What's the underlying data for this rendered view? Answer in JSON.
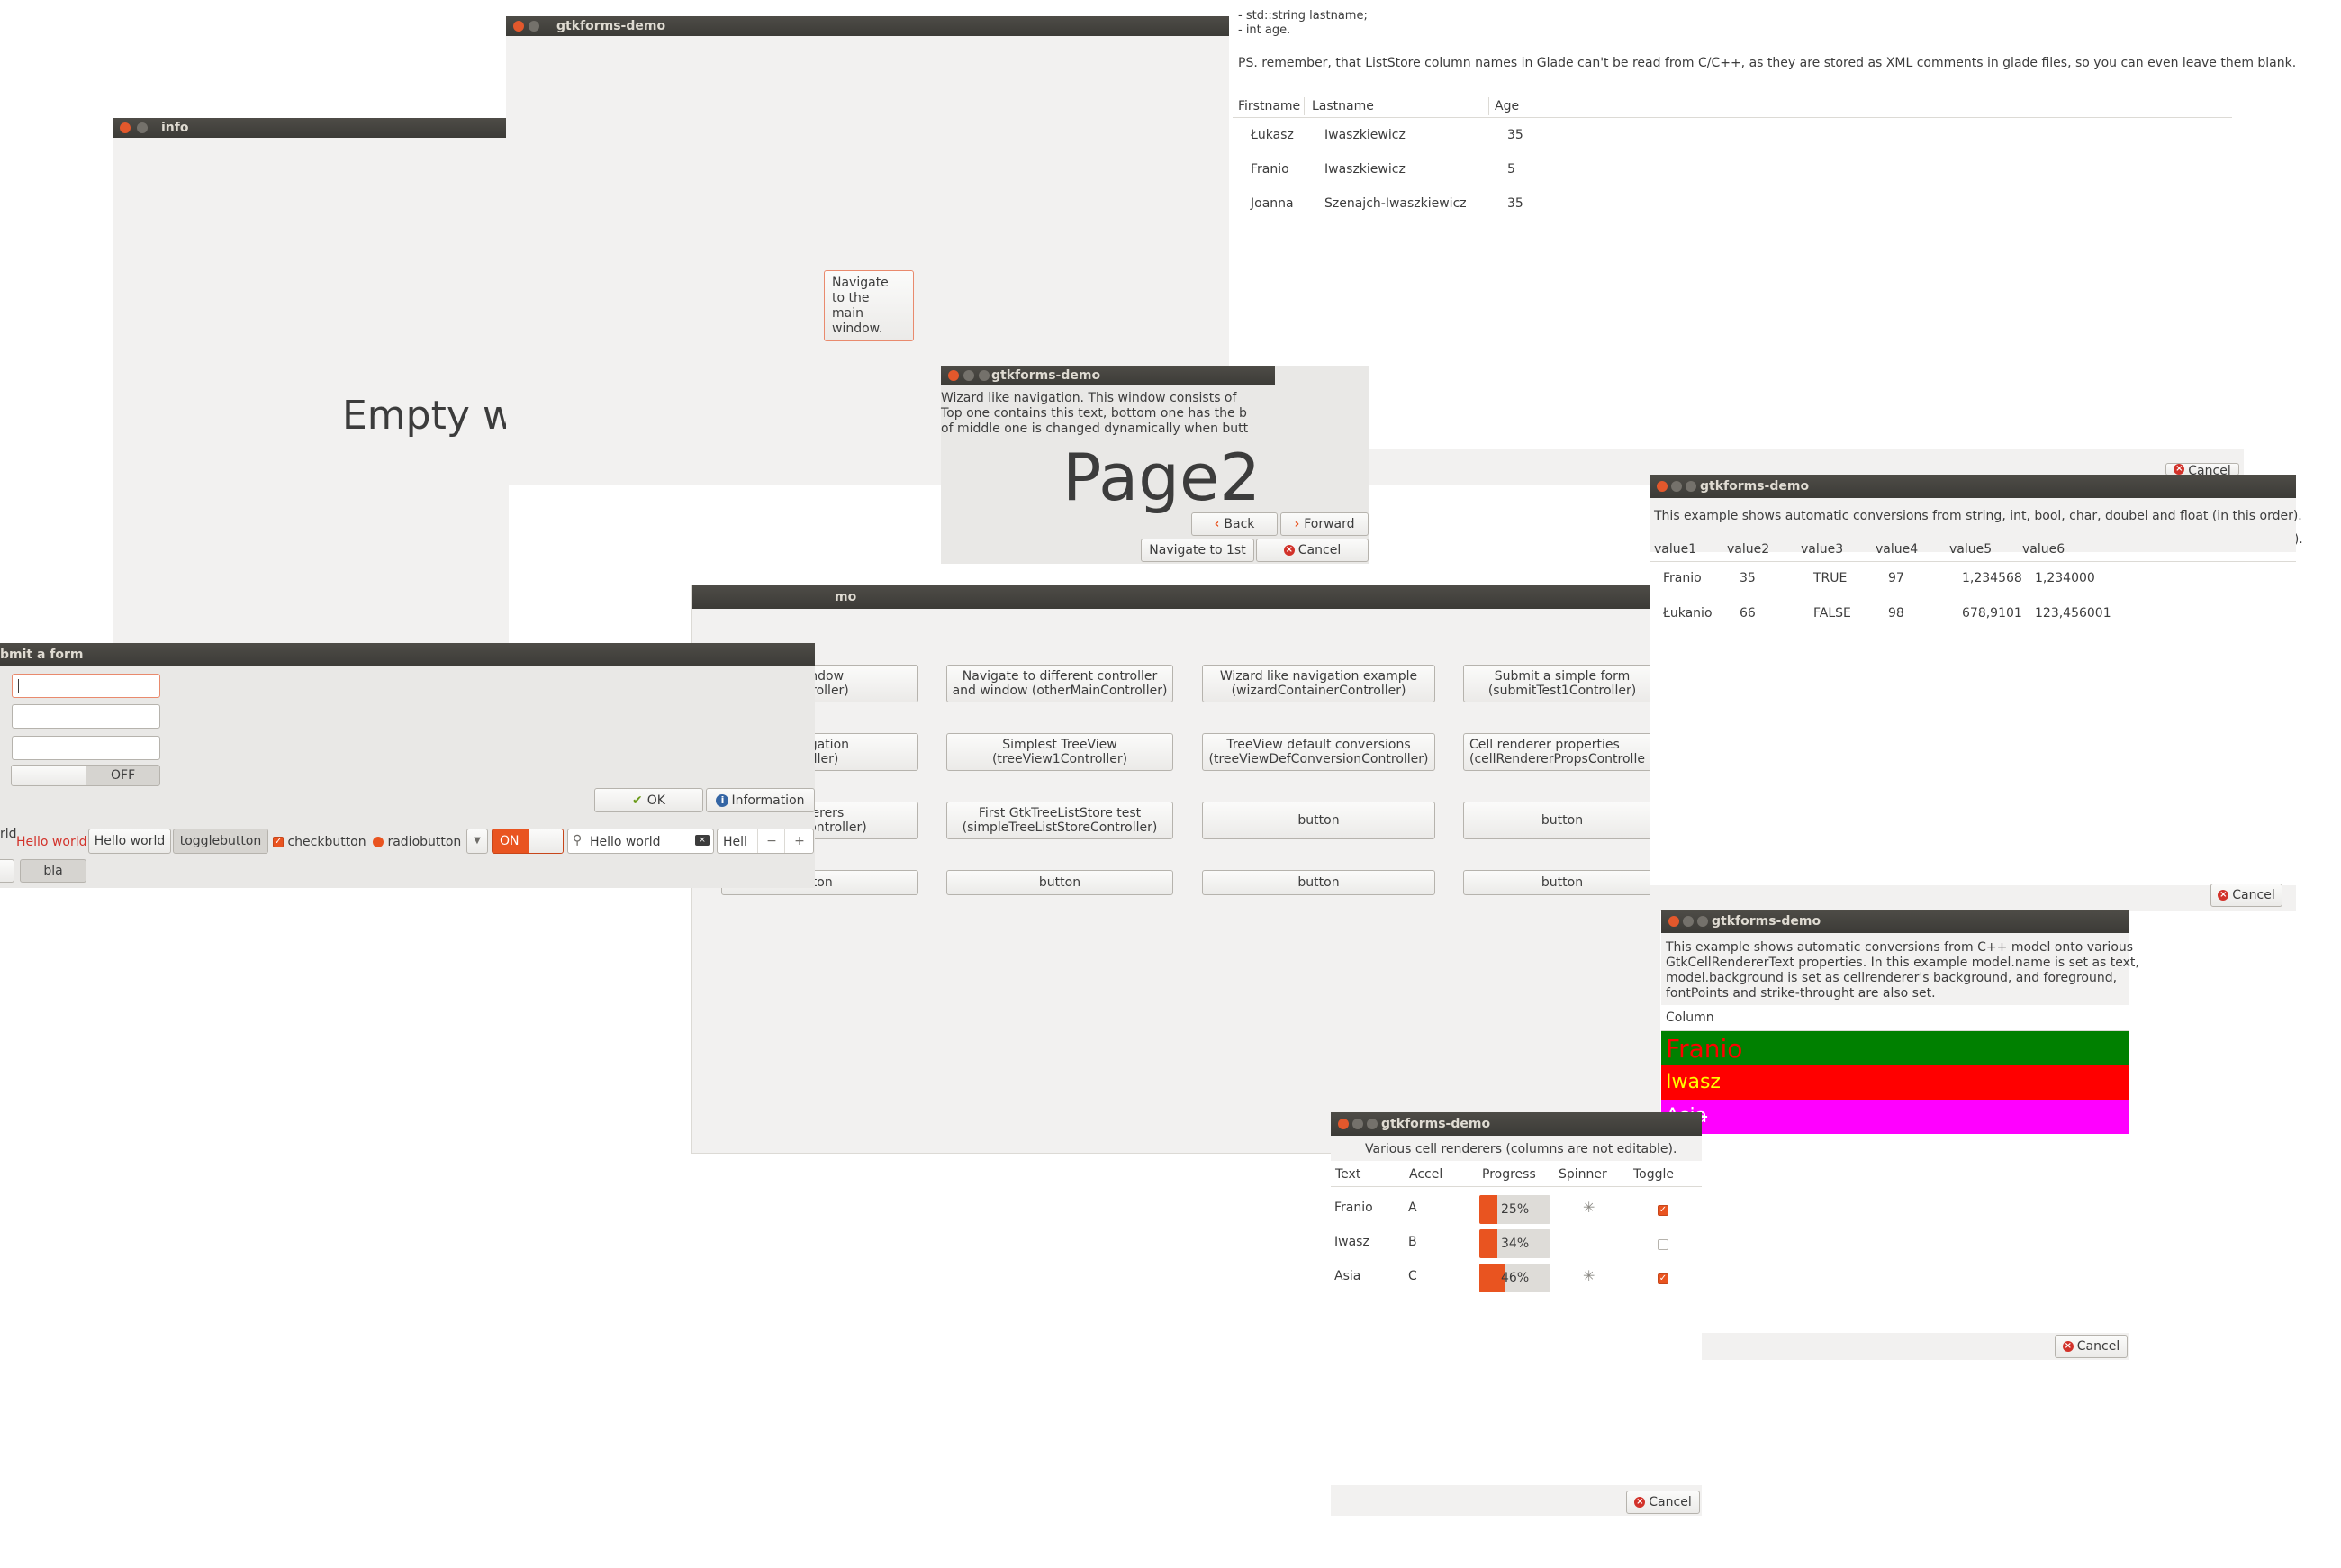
{
  "colors": {
    "accent": "#e95420",
    "titlebar": "#3c3b37",
    "window_bg": "#f2f1f0",
    "green_row": "#008000",
    "red_row": "#ff0000",
    "magenta_row": "#ff00ff"
  },
  "top_main": {
    "title": "gtkforms-demo",
    "nav_button": "Navigate to the main window.",
    "top_text_a": "- std::string lastname;",
    "top_text_b": "- int age.",
    "ps_text": "PS. remember, that ListStore column names in Glade can't be read from C/C++, as they are stored as XML comments in glade files, so you can even leave them blank.",
    "columns": [
      "Firstname",
      "Lastname",
      "Age"
    ],
    "rows": [
      [
        "Łukasz",
        "Iwaszkiewicz",
        "35"
      ],
      [
        "Franio",
        "Iwaszkiewicz",
        "5"
      ],
      [
        "Joanna",
        "Szenajch-Iwaszkiewicz",
        "35"
      ]
    ],
    "cancel_label": "Cancel"
  },
  "info": {
    "title": "info",
    "text": "Empty wi"
  },
  "wizard": {
    "title": "gtkforms-demo",
    "line1": "Wizard like navigation. This window consists of",
    "line2": "Top one contains this text, bottom one has the b",
    "line3": "of middle one is changed dynamically when butt",
    "page": "Page2",
    "back": "Back",
    "forward": "Forward",
    "navigate_first": "Navigate to 1st",
    "cancel": "Cancel"
  },
  "main": {
    "title": "mo",
    "buttons": [
      [
        "window\nontroller)",
        "Navigate to different controller\nand window (otherMainController)",
        "Wizard like navigation example\n(wizardContainerController)",
        "Submit a simple form\n(submitTest1Controller)"
      ],
      [
        "avigation\nroller)",
        "Simplest TreeView\n(treeView1Controller)",
        "TreeView default conversions\n(treeViewDefConversionController)",
        "Cell renderer properties\n(cellRendererPropsControlle"
      ],
      [
        "nderers\nropsController)",
        "First GtkTreeListStore test\n(simpleTreeListStoreController)",
        "button",
        "button"
      ],
      [
        "tton",
        "button",
        "button",
        "button"
      ]
    ]
  },
  "form": {
    "title": "bmit a form",
    "toggle_off": "OFF",
    "ok": "OK",
    "information": "Information",
    "row_label": "rld",
    "hello_red": "Hello world",
    "hello_button": "Hello world",
    "togglebutton": "togglebutton",
    "checkbutton": "checkbutton",
    "radiobutton": "radiobutton",
    "switch_on": "ON",
    "search_value": "Hello world",
    "spin_value": "Hell",
    "bla": "bla"
  },
  "conv": {
    "title": "gtkforms-demo",
    "desc": "This example shows automatic conversions from string, int, bool, char, doubel and float (in this order).",
    "columns": [
      "value1",
      "value2",
      "value3",
      "value4",
      "value5",
      "value6"
    ],
    "rows": [
      [
        "Franio",
        "35",
        "TRUE",
        "97",
        "1,234568",
        "1,234000"
      ],
      [
        "Łukanio",
        "66",
        "FALSE",
        "98",
        "678,9101",
        "123,456001"
      ]
    ],
    "cancel": "Cancel"
  },
  "props": {
    "title": "gtkforms-demo",
    "desc1": "This example shows automatic conversions from C++ model onto various",
    "desc2": "GtkCellRendererText properties. In this example model.name is set as text,",
    "desc3": "model.background is set as cellrenderer's background, and foreground,",
    "desc4": "fontPoints and strike-throught are also set.",
    "column": "Column",
    "rows": [
      "Franio",
      "Iwasz",
      "Asia"
    ],
    "cancel": "Cancel"
  },
  "renderers": {
    "title": "gtkforms-demo",
    "desc": "Various cell renderers (columns are not editable).",
    "columns": [
      "Text",
      "Accel",
      "Progress",
      "Spinner",
      "Toggle"
    ],
    "rows": [
      {
        "text": "Franio",
        "accel": "A",
        "progress_label": "25%",
        "progress": 0.25,
        "spinner": true,
        "toggle": true
      },
      {
        "text": "Iwasz",
        "accel": "B",
        "progress_label": "34%",
        "progress": 0.34,
        "spinner": false,
        "toggle": false
      },
      {
        "text": "Asia",
        "accel": "C",
        "progress_label": "46%",
        "progress": 0.46,
        "spinner": true,
        "toggle": true
      }
    ],
    "cancel": "Cancel"
  }
}
